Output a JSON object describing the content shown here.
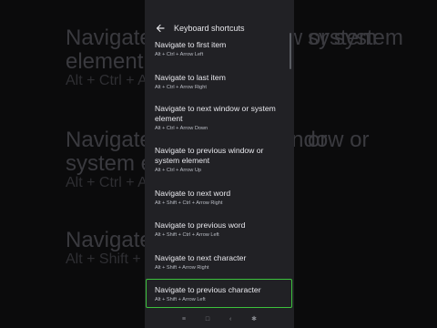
{
  "background": {
    "lines": [
      {
        "text": "Navigate to next window or system",
        "style": "big"
      },
      {
        "text": "element",
        "style": "big"
      },
      {
        "text": "Alt + Ctrl + Arrow Down",
        "style": "small"
      },
      {
        "text": "Navigate to previous window or",
        "style": "big"
      },
      {
        "text": "system element",
        "style": "big"
      },
      {
        "text": "Alt + Ctrl + Arrow Up",
        "style": "small"
      },
      {
        "text": "Navigate to next word",
        "style": "big"
      },
      {
        "text": "Alt + Shift + Ctrl + Arrow Right",
        "style": "small"
      }
    ]
  },
  "app_bar": {
    "title": "Keyboard shortcuts",
    "back_icon": "arrow-back-icon"
  },
  "items": [
    {
      "title": "Navigate to first item",
      "shortcut": "Alt + Ctrl + Arrow Left"
    },
    {
      "title": "Navigate to last item",
      "shortcut": "Alt + Ctrl + Arrow Right"
    },
    {
      "title": "Navigate to next window or system element",
      "shortcut": "Alt + Ctrl + Arrow Down"
    },
    {
      "title": "Navigate to previous window or system element",
      "shortcut": "Alt + Ctrl + Arrow Up"
    },
    {
      "title": "Navigate to next word",
      "shortcut": "Alt + Shift + Ctrl + Arrow Right"
    },
    {
      "title": "Navigate to previous word",
      "shortcut": "Alt + Shift + Ctrl + Arrow Left"
    },
    {
      "title": "Navigate to next character",
      "shortcut": "Alt + Shift + Arrow Right"
    },
    {
      "title": "Navigate to previous character",
      "shortcut": "Alt + Shift + Arrow Left"
    }
  ],
  "highlighted_item_index": 7,
  "colors": {
    "highlight": "#3cc23c",
    "surface": "#212125"
  },
  "nav_bar": {
    "icons": [
      "menu-icon",
      "home-icon",
      "back-icon",
      "accessibility-icon"
    ],
    "glyphs": [
      "≡",
      "□",
      "‹",
      "✱"
    ]
  }
}
